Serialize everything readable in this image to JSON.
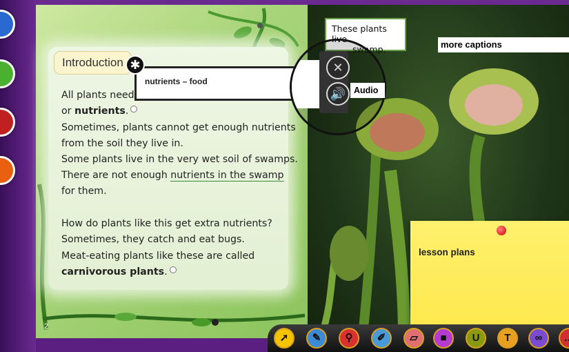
{
  "left_page": {
    "heading": "Introduction",
    "lines": [
      "All plants need",
      "or",
      "nutrients",
      "Sometimes, plants cannot get enough nutrients",
      "from the soil they live in.",
      "Some plants live in the very wet soil of swamps.",
      "There are not enough",
      "nutrients in the swamp",
      "for them.",
      "How do plants like this get extra nutrients?",
      "Sometimes, they catch and eat bugs.",
      "Meat-eating plants like these are called",
      "carnivorous plants"
    ],
    "page_number": "2"
  },
  "glossary_popup": {
    "text": "nutrients – food"
  },
  "magnifier": {
    "close_icon": "close-icon",
    "audio_icon": "speaker-icon",
    "audio_label": "Audio"
  },
  "right_page": {
    "caption_line1": "These plants live",
    "caption_line2": "swamp.",
    "more_captions": "more captions",
    "sticky_note": "lesson plans"
  },
  "toolbar": {
    "tools": [
      {
        "icon": "pointer-icon",
        "glyph": "➚",
        "color": "#f5c400"
      },
      {
        "icon": "pen-icon",
        "glyph": "✎",
        "color": "#3d8ad4"
      },
      {
        "icon": "zoom-icon",
        "glyph": "⚲",
        "color": "#d93030"
      },
      {
        "icon": "highlighter-icon",
        "glyph": "✐",
        "color": "#4a9ad8"
      },
      {
        "icon": "eraser-icon",
        "glyph": "▱",
        "color": "#e07070"
      },
      {
        "icon": "sticky-note-icon",
        "glyph": "■",
        "color": "#b53ad0"
      },
      {
        "icon": "underline-icon",
        "glyph": "U",
        "color": "#8a9a10"
      },
      {
        "icon": "text-icon",
        "glyph": "T",
        "color": "#e8a020"
      },
      {
        "icon": "link-icon",
        "glyph": "∞",
        "color": "#7a4ad0"
      },
      {
        "icon": "more-icon",
        "glyph": "…",
        "color": "#d03030"
      }
    ]
  },
  "side_buttons": [
    "#2a6ad0",
    "#4ab030",
    "#c02020",
    "#e86010"
  ]
}
